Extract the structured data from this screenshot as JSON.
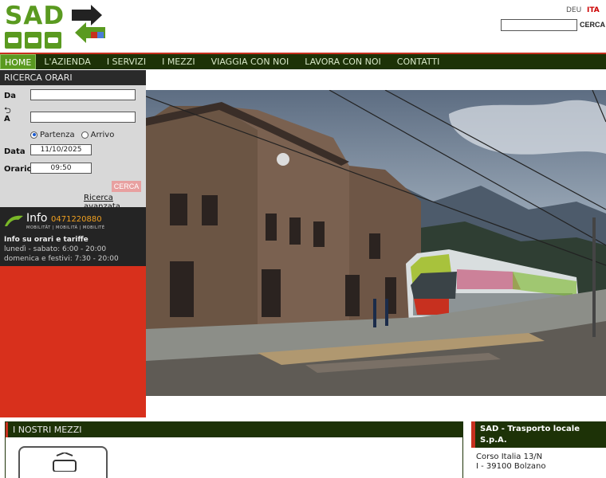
{
  "header": {
    "logo_text": "SAD",
    "lang_deu": "DEU",
    "lang_ita": "ITA",
    "search_button": "CERCA",
    "search_value": ""
  },
  "nav": {
    "items": [
      {
        "label": "HOME",
        "active": true
      },
      {
        "label": "L'AZIENDA"
      },
      {
        "label": "I SERVIZI"
      },
      {
        "label": "I MEZZI"
      },
      {
        "label": "VIAGGIA CON NOI"
      },
      {
        "label": "LAVORA CON NOI"
      },
      {
        "label": "CONTATTI"
      }
    ]
  },
  "ricerca": {
    "title": "RICERCA ORARI",
    "da_label": "Da",
    "a_label": "A",
    "da_value": "",
    "a_value": "",
    "partenza_label": "Partenza",
    "arrivo_label": "Arrivo",
    "selected": "partenza",
    "data_label": "Data",
    "data_value": "11/10/2025",
    "orario_label": "Orario",
    "orario_value": "09:50",
    "cerca_label": "CERCA",
    "advanced_link": "Ricerca avanzata"
  },
  "info": {
    "word": "Info",
    "phone": "0471220880",
    "subline": "MOBILITÄT | MOBILITÀ | MOBILITÉ",
    "title": "Info su orari e tariffe",
    "weekday_hours": "lunedì - sabato: 6:00 - 20:00",
    "holiday_hours": "domenica e festivi: 7:30 - 20:00"
  },
  "mezzi": {
    "title": "I NOSTRI MEZZI"
  },
  "company": {
    "title": "SAD - Trasporto locale S.p.A.",
    "address1": "Corso Italia 13/N",
    "address2": "I - 39100 Bolzano"
  },
  "colors": {
    "brand_green": "#5a9a20",
    "nav_dark": "#1d3207",
    "accent_red": "#c7301f"
  }
}
